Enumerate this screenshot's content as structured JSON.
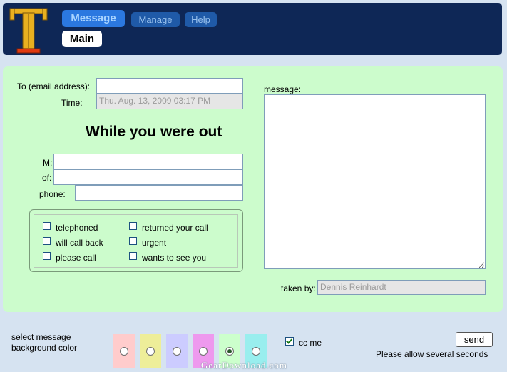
{
  "header": {
    "tabs": [
      {
        "label": "Message"
      },
      {
        "label": "Manage"
      },
      {
        "label": "Help"
      }
    ],
    "subtab": "Main"
  },
  "form": {
    "to_label": "To (email address):",
    "to_value": "",
    "time_label": "Time:",
    "time_value": "Thu. Aug. 13, 2009 03:17 PM",
    "heading": "While you were out",
    "m_label": "M:",
    "of_label": "of:",
    "phone_label": "phone:",
    "checkboxes": [
      {
        "label": "telephoned",
        "checked": false
      },
      {
        "label": "will call back",
        "checked": false
      },
      {
        "label": "please call",
        "checked": false
      },
      {
        "label": "returned your call",
        "checked": false
      },
      {
        "label": "urgent",
        "checked": false
      },
      {
        "label": "wants to see you",
        "checked": false
      }
    ],
    "message_label": "message:",
    "taken_by_label": "taken by:",
    "taken_by_value": "Dennis Reinhardt"
  },
  "footer": {
    "bg_label_line1": "select message",
    "bg_label_line2": "background color",
    "colors": [
      "#ffcccc",
      "#eeee99",
      "#ccccff",
      "#ee99ee",
      "#ccffcc",
      "#99eeee"
    ],
    "selected_color_index": 4,
    "cc_me_label": "cc me",
    "cc_me_checked": true,
    "send_label": "send",
    "allow_note": "Please allow several seconds"
  },
  "watermark": "GearDownload.com"
}
